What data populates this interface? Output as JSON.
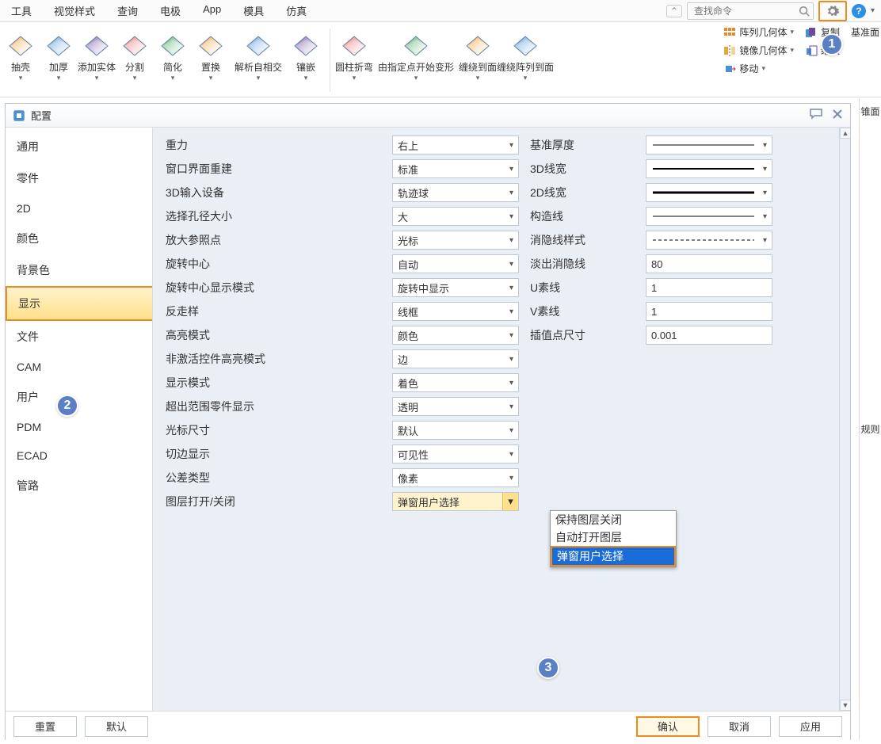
{
  "menubar": {
    "items": [
      "工具",
      "视觉样式",
      "查询",
      "电极",
      "App",
      "模具",
      "仿真"
    ],
    "search_placeholder": "查找命令"
  },
  "ribbon": {
    "buttons": [
      {
        "label": "抽壳"
      },
      {
        "label": "加厚"
      },
      {
        "label": "添加实体"
      },
      {
        "label": "分割"
      },
      {
        "label": "简化"
      },
      {
        "label": "置换"
      },
      {
        "label": "解析自相交"
      },
      {
        "label": "镶嵌"
      },
      {
        "label": "圆柱折弯"
      },
      {
        "label": "由指定点开始变形"
      },
      {
        "label": "缠绕到面"
      },
      {
        "label": "缠绕阵列到面"
      }
    ],
    "right_rows": [
      [
        "阵列几何体",
        "复制",
        "基准面"
      ],
      [
        "镜像几何体",
        "缩放"
      ],
      [
        "移动"
      ]
    ]
  },
  "dialog": {
    "title": "配置",
    "sidebar_items": [
      "通用",
      "零件",
      "2D",
      "颜色",
      "背景色",
      "显示",
      "文件",
      "CAM",
      "用户",
      "PDM",
      "ECAD",
      "管路"
    ],
    "sidebar_selected_index": 5,
    "settings_left": [
      {
        "label": "重力",
        "value": "右上"
      },
      {
        "label": "窗口界面重建",
        "value": "标准"
      },
      {
        "label": "3D输入设备",
        "value": "轨迹球"
      },
      {
        "label": "选择孔径大小",
        "value": "大"
      },
      {
        "label": "放大参照点",
        "value": "光标"
      },
      {
        "label": "旋转中心",
        "value": "自动"
      },
      {
        "label": "旋转中心显示模式",
        "value": "旋转中显示"
      },
      {
        "label": "反走样",
        "value": "线框"
      },
      {
        "label": "高亮模式",
        "value": "颜色"
      },
      {
        "label": "非激活控件高亮模式",
        "value": "边"
      },
      {
        "label": "显示模式",
        "value": "着色"
      },
      {
        "label": "超出范围零件显示",
        "value": "透明"
      },
      {
        "label": "光标尺寸",
        "value": "默认"
      },
      {
        "label": "切边显示",
        "value": "可见性"
      },
      {
        "label": "公差类型",
        "value": "像素"
      },
      {
        "label": "图层打开/关闭",
        "value": "弹窗用户选择"
      }
    ],
    "settings_right": [
      {
        "label": "基准厚度",
        "type": "line",
        "style": "thin"
      },
      {
        "label": "3D线宽",
        "type": "line",
        "style": "med"
      },
      {
        "label": "2D线宽",
        "type": "line",
        "style": "thick"
      },
      {
        "label": "构造线",
        "type": "line",
        "style": "thin"
      },
      {
        "label": "消隐线样式",
        "type": "line",
        "style": "dash"
      },
      {
        "label": "淡出消隐线",
        "type": "text",
        "value": "80"
      },
      {
        "label": "U素线",
        "type": "text",
        "value": "1"
      },
      {
        "label": "V素线",
        "type": "text",
        "value": "1"
      },
      {
        "label": "插值点尺寸",
        "type": "text",
        "value": "0.001"
      }
    ],
    "dropdown_options": [
      "保持图层关闭",
      "自动打开图层",
      "弹窗用户选择"
    ],
    "dropdown_selected_index": 2,
    "buttons": {
      "reset": "重置",
      "default": "默认",
      "ok": "确认",
      "cancel": "取消",
      "apply": "应用"
    }
  },
  "badges": {
    "one": "1",
    "two": "2",
    "three": "3"
  },
  "right_glimpse": [
    "锥面",
    "规则"
  ]
}
